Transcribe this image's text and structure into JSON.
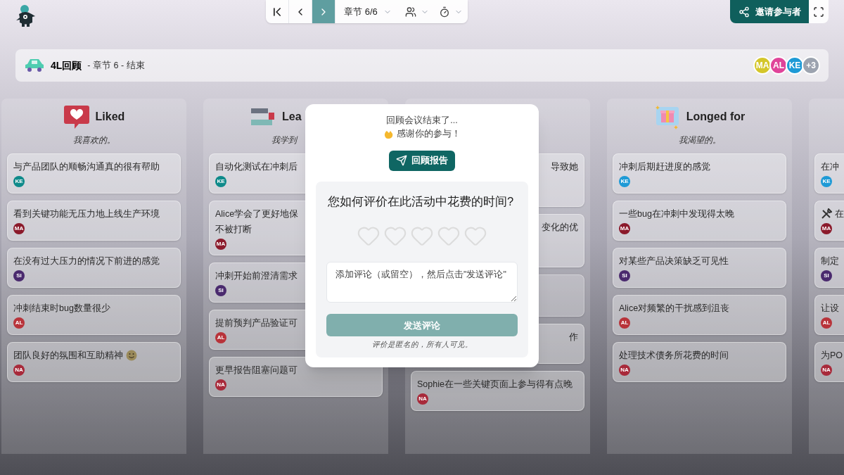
{
  "toolbar": {
    "nav": [
      {
        "kind": "first",
        "selected": false
      },
      {
        "kind": "prev",
        "selected": false
      },
      {
        "kind": "next",
        "selected": true
      }
    ],
    "section": "章节 6/6",
    "menus": [
      {
        "kind": "participants"
      },
      {
        "kind": "timer"
      }
    ],
    "invite": "邀请参与者"
  },
  "header": {
    "title": "4L回顾",
    "subtitle": "- 章节 6 - 结束",
    "avatars": [
      {
        "initials": "MA",
        "color": "#d4c62a"
      },
      {
        "initials": "AL",
        "color": "#e0449a"
      },
      {
        "initials": "KE",
        "color": "#1e9ad6"
      },
      {
        "initials": "+3",
        "color": "#9ca3af"
      }
    ]
  },
  "columns": [
    {
      "kind": "liked",
      "title": "Liked",
      "subtitle": "我喜欢的。",
      "items": [
        {
          "kind": "whole",
          "text": "与产品团队的顺畅沟通真的很有帮助",
          "avatar": {
            "initials": "KE",
            "color": "#0e8a8a"
          }
        },
        {
          "kind": "whole",
          "text": "看到关键功能无压力地上线生产环境",
          "avatar": {
            "initials": "MA",
            "color": "#8b1a2b"
          }
        },
        {
          "kind": "whole",
          "text": "在没有过大压力的情况下前进的感觉",
          "avatar": {
            "initials": "SI",
            "color": "#4a2a6e"
          }
        },
        {
          "kind": "whole",
          "text": "冲刺结束时bug数量很少",
          "avatar": {
            "initials": "AL",
            "color": "#b8333a"
          }
        },
        {
          "kind": "smiley",
          "text": "团队良好的氛围和互助精神",
          "avatar": {
            "initials": "NA",
            "color": "#a82a3a"
          }
        }
      ]
    },
    {
      "kind": "learned",
      "title": "Lea",
      "subtitle": "我学到",
      "items": [
        {
          "kind": "head",
          "text": "自动化测试在冲刺后",
          "avatar": {
            "initials": "KE",
            "color": "#0e8a8a"
          }
        },
        {
          "kind": "head",
          "text": "Alice学会了更好地保",
          "text2": "不被打断",
          "avatar": {
            "initials": "MA",
            "color": "#8b1a2b"
          }
        },
        {
          "kind": "head",
          "text": "冲刺开始前澄清需求",
          "avatar": {
            "initials": "SI",
            "color": "#4a2a6e"
          }
        },
        {
          "kind": "head",
          "text": "提前预判产品验证可",
          "avatar": {
            "initials": "AL",
            "color": "#b8333a"
          }
        },
        {
          "kind": "whole",
          "text": "更早报告阻塞问题可",
          "avatar": {
            "initials": "NA",
            "color": "#a82a3a"
          }
        }
      ]
    },
    {
      "kind": "hidden",
      "items": [
        {
          "kind": "tail_tall",
          "text": "导致她"
        },
        {
          "kind": "tail_tall",
          "text": "变化的优"
        },
        {
          "kind": "hidden"
        },
        {
          "kind": "tail",
          "text": "作"
        },
        {
          "kind": "whole",
          "text": "Sophie在一些关键页面上参与得有点晚",
          "avatar": {
            "initials": "NA",
            "color": "#a82a3a"
          }
        }
      ]
    },
    {
      "kind": "longed",
      "title": "Longed for",
      "subtitle": "我渴望的。",
      "items": [
        {
          "kind": "whole",
          "text": "冲刺后期赶进度的感觉",
          "avatar": {
            "initials": "KE",
            "color": "#1e9ad6"
          }
        },
        {
          "kind": "whole",
          "text": "一些bug在冲刺中发现得太晚",
          "avatar": {
            "initials": "MA",
            "color": "#8b1a2b"
          }
        },
        {
          "kind": "whole",
          "text": "对某些产品决策缺乏可见性",
          "avatar": {
            "initials": "SI",
            "color": "#4a2a6e"
          }
        },
        {
          "kind": "whole",
          "text": "Alice对频繁的干扰感到沮丧",
          "avatar": {
            "initials": "AL",
            "color": "#b8333a"
          }
        },
        {
          "kind": "whole",
          "text": "处理技术债务所花费的时间",
          "avatar": {
            "initials": "NA",
            "color": "#a82a3a"
          }
        }
      ]
    },
    {
      "kind": "hidden",
      "items": [
        {
          "kind": "whole",
          "text": "在冲",
          "avatar": {
            "initials": "KE",
            "color": "#1e9ad6"
          }
        },
        {
          "kind": "tools",
          "text": "在",
          "avatar": {
            "initials": "MA",
            "color": "#8b1a2b"
          }
        },
        {
          "kind": "whole",
          "text": "制定",
          "avatar": {
            "initials": "SI",
            "color": "#4a2a6e"
          }
        },
        {
          "kind": "whole",
          "text": "让设",
          "avatar": {
            "initials": "AL",
            "color": "#b8333a"
          }
        },
        {
          "kind": "whole",
          "text": "为PO",
          "avatar": {
            "initials": "NA",
            "color": "#a82a3a"
          }
        }
      ]
    }
  ],
  "dialog": {
    "line1": "回顾会议结束了...",
    "line2": "感谢你的参与！",
    "report_button": "回顾报告",
    "question": "您如何评价在此活动中花费的时间?",
    "stars": 0,
    "comment": {
      "placeholder": "添加评论（或留空），然后点击\"发送评论\""
    },
    "send_button": {
      "label": "发送评论",
      "disabled": true
    },
    "note": "评价是匿名的，所有人可见。"
  }
}
